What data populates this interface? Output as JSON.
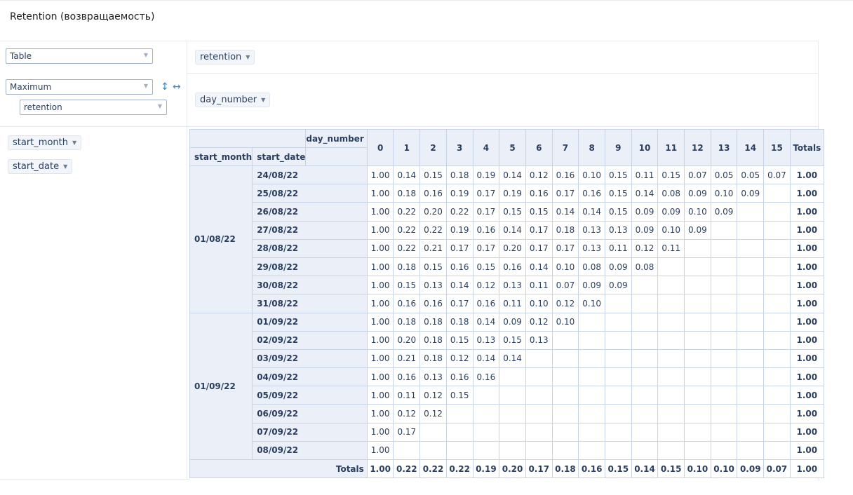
{
  "page_title": "Retention (возвращаемость)",
  "renderer_select": {
    "value": "Table"
  },
  "aggregator_select": {
    "value": "Maximum"
  },
  "aggregator_field_select": {
    "value": "retention"
  },
  "vals_chip": {
    "label": "retention"
  },
  "col_chip": {
    "label": "day_number"
  },
  "row_chips": [
    "start_month",
    "start_date"
  ],
  "table": {
    "col_axis_label": "day_number",
    "row_headers": [
      "start_month",
      "start_date"
    ],
    "columns": [
      "0",
      "1",
      "2",
      "3",
      "4",
      "5",
      "6",
      "7",
      "8",
      "9",
      "10",
      "11",
      "12",
      "13",
      "14",
      "15"
    ],
    "totals_label": "Totals",
    "groups": [
      {
        "month": "01/08/22",
        "rows": [
          {
            "date": "24/08/22",
            "values": [
              "1.00",
              "0.14",
              "0.15",
              "0.18",
              "0.19",
              "0.14",
              "0.12",
              "0.16",
              "0.10",
              "0.15",
              "0.11",
              "0.15",
              "0.07",
              "0.05",
              "0.05",
              "0.07"
            ],
            "total": "1.00"
          },
          {
            "date": "25/08/22",
            "values": [
              "1.00",
              "0.18",
              "0.16",
              "0.19",
              "0.17",
              "0.19",
              "0.16",
              "0.17",
              "0.16",
              "0.15",
              "0.14",
              "0.08",
              "0.09",
              "0.10",
              "0.09",
              ""
            ],
            "total": "1.00"
          },
          {
            "date": "26/08/22",
            "values": [
              "1.00",
              "0.22",
              "0.20",
              "0.22",
              "0.17",
              "0.15",
              "0.15",
              "0.14",
              "0.14",
              "0.15",
              "0.09",
              "0.09",
              "0.10",
              "0.09",
              "",
              ""
            ],
            "total": "1.00"
          },
          {
            "date": "27/08/22",
            "values": [
              "1.00",
              "0.22",
              "0.22",
              "0.19",
              "0.16",
              "0.14",
              "0.17",
              "0.18",
              "0.13",
              "0.13",
              "0.09",
              "0.10",
              "0.09",
              "",
              "",
              ""
            ],
            "total": "1.00"
          },
          {
            "date": "28/08/22",
            "values": [
              "1.00",
              "0.22",
              "0.21",
              "0.17",
              "0.17",
              "0.20",
              "0.17",
              "0.17",
              "0.13",
              "0.11",
              "0.12",
              "0.11",
              "",
              "",
              "",
              ""
            ],
            "total": "1.00"
          },
          {
            "date": "29/08/22",
            "values": [
              "1.00",
              "0.18",
              "0.15",
              "0.16",
              "0.15",
              "0.16",
              "0.14",
              "0.10",
              "0.08",
              "0.09",
              "0.08",
              "",
              "",
              "",
              "",
              ""
            ],
            "total": "1.00"
          },
          {
            "date": "30/08/22",
            "values": [
              "1.00",
              "0.15",
              "0.13",
              "0.14",
              "0.12",
              "0.13",
              "0.11",
              "0.07",
              "0.09",
              "0.09",
              "",
              "",
              "",
              "",
              "",
              ""
            ],
            "total": "1.00"
          },
          {
            "date": "31/08/22",
            "values": [
              "1.00",
              "0.16",
              "0.16",
              "0.17",
              "0.16",
              "0.11",
              "0.10",
              "0.12",
              "0.10",
              "",
              "",
              "",
              "",
              "",
              "",
              ""
            ],
            "total": "1.00"
          }
        ]
      },
      {
        "month": "01/09/22",
        "rows": [
          {
            "date": "01/09/22",
            "values": [
              "1.00",
              "0.18",
              "0.18",
              "0.18",
              "0.14",
              "0.09",
              "0.12",
              "0.10",
              "",
              "",
              "",
              "",
              "",
              "",
              "",
              ""
            ],
            "total": "1.00"
          },
          {
            "date": "02/09/22",
            "values": [
              "1.00",
              "0.20",
              "0.18",
              "0.15",
              "0.13",
              "0.15",
              "0.13",
              "",
              "",
              "",
              "",
              "",
              "",
              "",
              "",
              ""
            ],
            "total": "1.00"
          },
          {
            "date": "03/09/22",
            "values": [
              "1.00",
              "0.21",
              "0.18",
              "0.12",
              "0.14",
              "0.14",
              "",
              "",
              "",
              "",
              "",
              "",
              "",
              "",
              "",
              ""
            ],
            "total": "1.00"
          },
          {
            "date": "04/09/22",
            "values": [
              "1.00",
              "0.16",
              "0.13",
              "0.16",
              "0.16",
              "",
              "",
              "",
              "",
              "",
              "",
              "",
              "",
              "",
              "",
              ""
            ],
            "total": "1.00"
          },
          {
            "date": "05/09/22",
            "values": [
              "1.00",
              "0.11",
              "0.12",
              "0.15",
              "",
              "",
              "",
              "",
              "",
              "",
              "",
              "",
              "",
              "",
              "",
              ""
            ],
            "total": "1.00"
          },
          {
            "date": "06/09/22",
            "values": [
              "1.00",
              "0.12",
              "0.12",
              "",
              "",
              "",
              "",
              "",
              "",
              "",
              "",
              "",
              "",
              "",
              "",
              ""
            ],
            "total": "1.00"
          },
          {
            "date": "07/09/22",
            "values": [
              "1.00",
              "0.17",
              "",
              "",
              "",
              "",
              "",
              "",
              "",
              "",
              "",
              "",
              "",
              "",
              "",
              ""
            ],
            "total": "1.00"
          },
          {
            "date": "08/09/22",
            "values": [
              "1.00",
              "",
              "",
              "",
              "",
              "",
              "",
              "",
              "",
              "",
              "",
              "",
              "",
              "",
              "",
              ""
            ],
            "total": "1.00"
          }
        ]
      }
    ],
    "totals_row": [
      "1.00",
      "0.22",
      "0.22",
      "0.22",
      "0.19",
      "0.20",
      "0.17",
      "0.18",
      "0.16",
      "0.15",
      "0.14",
      "0.15",
      "0.10",
      "0.10",
      "0.09",
      "0.07"
    ],
    "grand_total": "1.00"
  }
}
